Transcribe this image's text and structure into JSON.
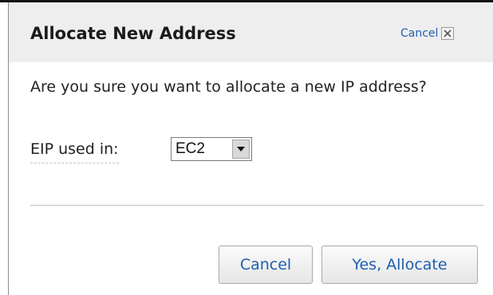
{
  "dialog": {
    "title": "Allocate New Address",
    "header_cancel_label": "Cancel",
    "question": "Are you sure you want to allocate a new IP address?",
    "eip_label": "EIP used in:",
    "eip_select": {
      "selected": "EC2"
    },
    "buttons": {
      "cancel": "Cancel",
      "confirm": "Yes, Allocate"
    }
  },
  "colors": {
    "link_blue": "#1f5fb0",
    "header_bg": "#eeeeee",
    "divider": "#bdbdbd"
  },
  "icons": {
    "close": "close-icon",
    "dropdown": "chevron-down-icon"
  }
}
